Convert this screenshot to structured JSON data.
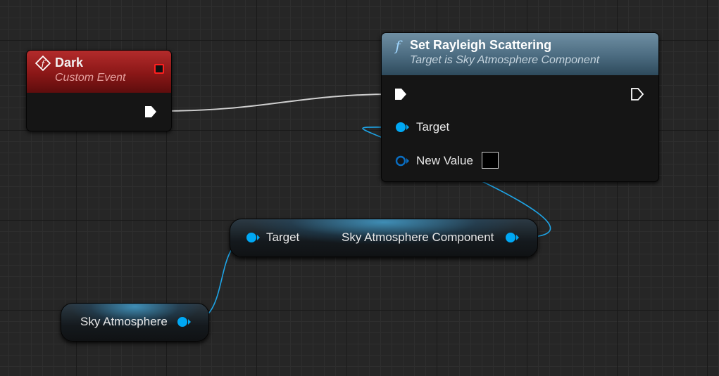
{
  "event_node": {
    "title": "Dark",
    "subtitle": "Custom Event",
    "icon": "custom-event-icon",
    "header_color": "#9b1f1f"
  },
  "function_node": {
    "title": "Set Rayleigh Scattering",
    "subtitle": "Target is Sky Atmosphere Component",
    "icon": "function-f-icon",
    "header_color": "#5a7b90",
    "pins": {
      "target_label": "Target",
      "new_value_label": "New Value",
      "new_value_color": "#000000"
    }
  },
  "getter_node": {
    "input_label": "Target",
    "output_label": "Sky Atmosphere Component"
  },
  "variable_node": {
    "label": "Sky Atmosphere"
  },
  "colors": {
    "object_pin": "#00a8f4",
    "exec_wire": "#d9d9d9",
    "object_wire": "#1ea4e6"
  }
}
